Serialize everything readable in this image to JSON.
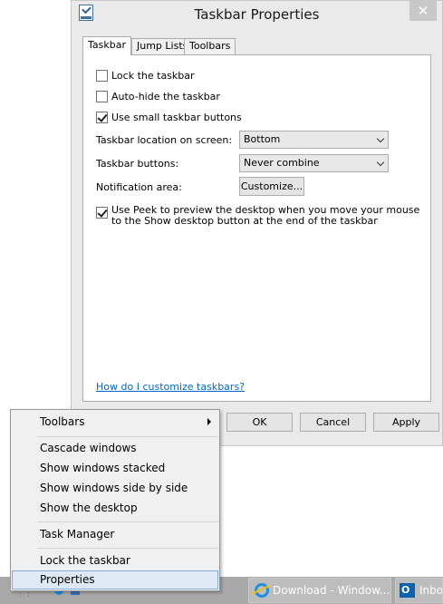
{
  "dialog": {
    "title": "Taskbar Properties",
    "tabs": [
      "Taskbar",
      "Jump Lists",
      "Toolbars"
    ],
    "options": {
      "lock_taskbar": {
        "label": "Lock the taskbar",
        "checked": false
      },
      "auto_hide": {
        "label": "Auto-hide the taskbar",
        "checked": false
      },
      "small_buttons": {
        "label": "Use small taskbar buttons",
        "checked": true
      }
    },
    "location_label": "Taskbar location on screen:",
    "location_value": "Bottom",
    "buttons_label": "Taskbar buttons:",
    "buttons_value": "Never combine",
    "notification_label": "Notification area:",
    "customize_button": "Customize...",
    "peek": {
      "label": "Use Peek to preview the desktop when you move your mouse to the Show desktop button at the end of the taskbar",
      "checked": true
    },
    "help_link": "How do I customize taskbars?",
    "ok": "OK",
    "cancel": "Cancel",
    "apply": "Apply"
  },
  "context_menu": {
    "items": [
      "Toolbars",
      "Cascade windows",
      "Show windows stacked",
      "Show windows side by side",
      "Show the desktop",
      "Task Manager",
      "Lock the taskbar",
      "Properties"
    ],
    "highlighted": "Properties"
  },
  "taskbar": {
    "buttons": [
      {
        "label": "Download - Window...",
        "icon": "ie-icon"
      },
      {
        "label": "Inbox",
        "icon": "outlook-icon"
      }
    ]
  },
  "colors": {
    "link": "#0066cc",
    "menu_highlight": "#dfe9f5",
    "taskbar": "#a9a9a9"
  }
}
